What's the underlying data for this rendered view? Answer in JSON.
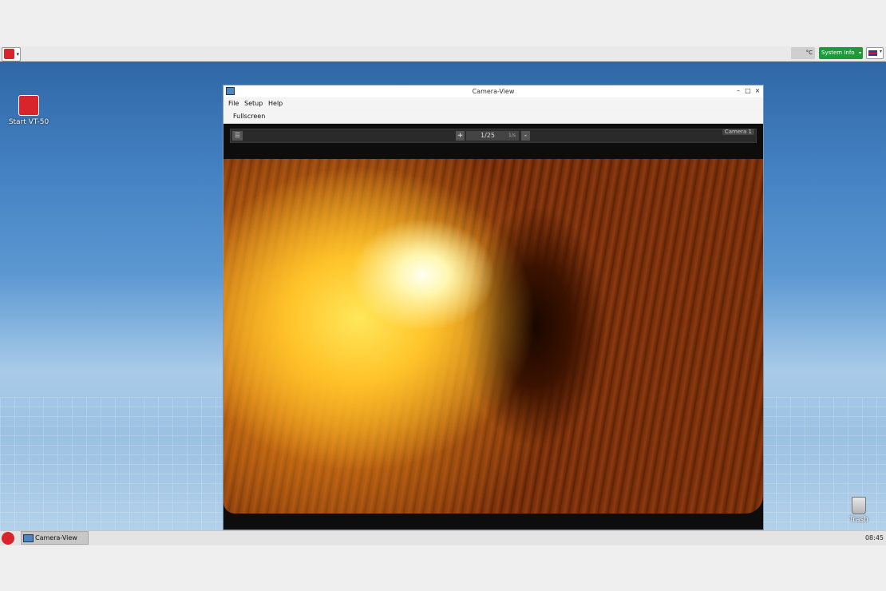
{
  "top_panel": {
    "temperature_unit": "°C",
    "system_info_label": "System Info"
  },
  "desktop": {
    "start_icon_label": "Start VT-50",
    "trash_label": "Trash"
  },
  "window": {
    "title": "Camera-View",
    "controls": {
      "minimize": "–",
      "maximize": "□",
      "close": "×"
    },
    "menu": [
      {
        "label": "File"
      },
      {
        "label": "Setup"
      },
      {
        "label": "Help"
      }
    ],
    "toolbar": {
      "fullscreen_label": "Fullscreen"
    },
    "video": {
      "menu_glyph": "☰",
      "plus_label": "+",
      "minus_label": "-",
      "shutter_value": "1/25",
      "shutter_unit": "1/s",
      "camera_label": "Camera 1"
    }
  },
  "taskbar": {
    "task_label": "Camera-View",
    "clock": "08:45"
  },
  "colors": {
    "accent_red": "#d8242b",
    "system_info_green": "#1f9a3a"
  }
}
